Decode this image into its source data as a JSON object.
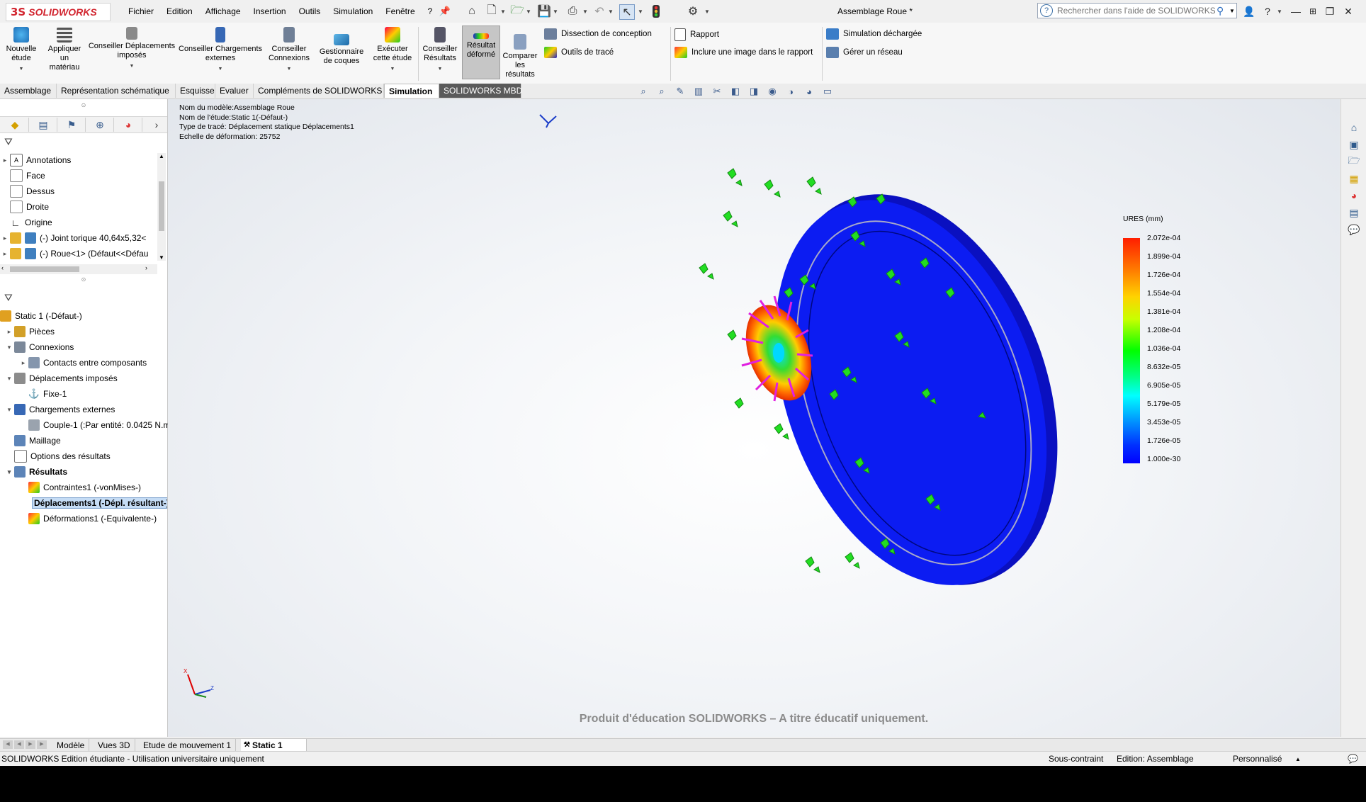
{
  "app": {
    "brand": "SOLIDWORKS",
    "logo_mark": "3S",
    "document_title": "Assemblage Roue *"
  },
  "menu": [
    "Fichier",
    "Edition",
    "Affichage",
    "Insertion",
    "Outils",
    "Simulation",
    "Fenêtre",
    "?"
  ],
  "help_search": {
    "placeholder": "Rechercher dans l'aide de SOLIDWORKS"
  },
  "window_controls": {
    "minimize": "—",
    "restore": "❐",
    "close": "✕"
  },
  "ribbon": {
    "new_study": "Nouvelle étude",
    "apply_material": "Appliquer un matériau",
    "advise_fixtures": "Conseiller Déplacements imposés",
    "advise_loads": "Conseiller Chargements externes",
    "advise_connections": "Conseiller Connexions",
    "shell_manager": "Gestionnaire de coques",
    "run_study": "Exécuter cette étude",
    "advise_results": "Conseiller Résultats",
    "deformed_result": "Résultat déformé",
    "compare_results": "Comparer les résultats",
    "design_insight": "Dissection de conception",
    "plot_tools": "Outils de tracé",
    "report": "Rapport",
    "include_image": "Inclure une image dans le rapport",
    "offloaded_sim": "Simulation déchargée",
    "manage_network": "Gérer un réseau"
  },
  "command_tabs": [
    "Assemblage",
    "Représentation schématique",
    "Esquisse",
    "Evaluer",
    "Compléments de SOLIDWORKS",
    "Simulation",
    "SOLIDWORKS MBD"
  ],
  "command_tabs_active": "Simulation",
  "feature_tree": [
    {
      "label": "Annotations",
      "exp": "▸"
    },
    {
      "label": "Face",
      "exp": ""
    },
    {
      "label": "Dessus",
      "exp": ""
    },
    {
      "label": "Droite",
      "exp": ""
    },
    {
      "label": "Origine",
      "exp": ""
    },
    {
      "label": "(-) Joint torique 40,64x5,32<",
      "exp": "▸"
    },
    {
      "label": "(-) Roue<1> (Défaut<<Défau",
      "exp": "▸"
    }
  ],
  "study_tree": {
    "root": "Static 1 (-Défaut-)",
    "parts": "Pièces",
    "connections": "Connexions",
    "contacts": "Contacts entre composants",
    "fixtures": "Déplacements imposés",
    "fixed": "Fixe-1",
    "external_loads": "Chargements externes",
    "torque": "Couple-1 (:Par entité: 0.0425 N.m",
    "mesh": "Maillage",
    "result_options": "Options des résultats",
    "results": "Résultats",
    "stress": "Contraintes1 (-vonMises-)",
    "displacement": "Déplacements1 (-Dépl. résultant-)",
    "strain": "Déformations1 (-Equivalente-)"
  },
  "study_info": {
    "model": "Nom du modèle:Assemblage Roue",
    "study": "Nom de l'étude:Static 1(-Défaut-)",
    "plot_type": "Type de tracé: Déplacement statique Déplacements1",
    "deformation_scale": "Echelle de déformation: 25752"
  },
  "legend": {
    "title": "URES (mm)",
    "values": [
      "2.072e-04",
      "1.899e-04",
      "1.726e-04",
      "1.554e-04",
      "1.381e-04",
      "1.208e-04",
      "1.036e-04",
      "8.632e-05",
      "6.905e-05",
      "5.179e-05",
      "3.453e-05",
      "1.726e-05",
      "1.000e-30"
    ]
  },
  "watermark": "Produit d'éducation SOLIDWORKS – A titre éducatif uniquement.",
  "bottom_tabs": [
    "Modèle",
    "Vues 3D",
    "Etude de mouvement 1",
    "Static 1"
  ],
  "bottom_tabs_active": "Static 1",
  "status": {
    "left": "SOLIDWORKS Edition étudiante - Utilisation universitaire uniquement",
    "constraint": "Sous-contraint",
    "edit_mode": "Edition: Assemblage",
    "custom": "Personnalisé"
  },
  "colors": {
    "brand_red": "#d22630",
    "part_blue": "#0a1cf0",
    "fixture_green": "#22dd22",
    "load_magenta": "#e020e0"
  }
}
